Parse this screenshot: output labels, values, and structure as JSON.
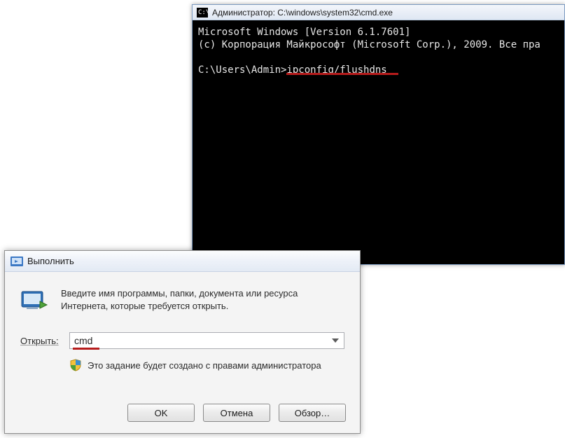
{
  "cmd": {
    "title": "Администратор: C:\\windows\\system32\\cmd.exe",
    "line1": "Microsoft Windows [Version 6.1.7601]",
    "line2": "(c) Корпорация Майкрософт (Microsoft Corp.), 2009. Все пра",
    "prompt_prefix": "C:\\Users\\Admin>",
    "prompt_command": "ipconfig/flushdns"
  },
  "run": {
    "title": "Выполнить",
    "description": "Введите имя программы, папки, документа или ресурса Интернета, которые требуется открыть.",
    "open_label": "Открыть:",
    "open_value": "cmd",
    "admin_note": "Это задание будет создано с правами администратора",
    "buttons": {
      "ok": "OK",
      "cancel": "Отмена",
      "browse": "Обзор…"
    }
  }
}
